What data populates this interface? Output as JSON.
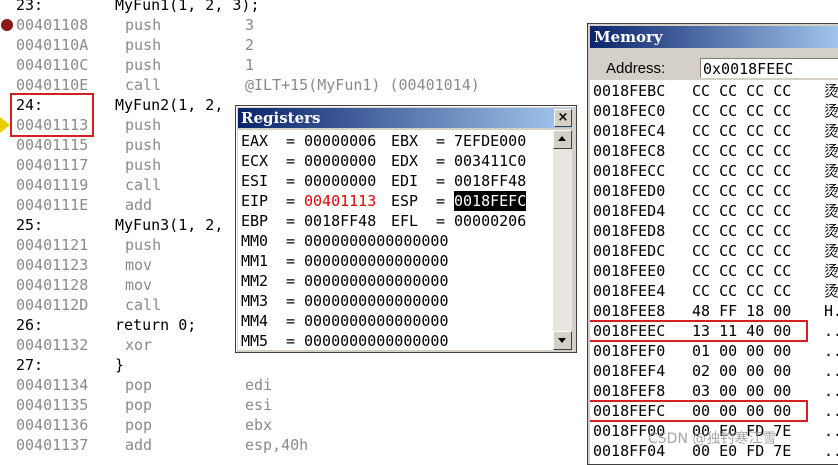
{
  "disassembly": [
    {
      "kind": "src",
      "num": "23:",
      "code": "MyFun1(1, 2, 3);"
    },
    {
      "kind": "asm",
      "addr": "00401108",
      "mnemonic": "push",
      "operand": "3",
      "marker": "breakpoint"
    },
    {
      "kind": "asm",
      "addr": "0040110A",
      "mnemonic": "push",
      "operand": "2"
    },
    {
      "kind": "asm",
      "addr": "0040110C",
      "mnemonic": "push",
      "operand": "1"
    },
    {
      "kind": "asm",
      "addr": "0040110E",
      "mnemonic": "call",
      "operand": "@ILT+15(MyFun1) (00401014)"
    },
    {
      "kind": "src",
      "num": "24:",
      "code": "MyFun2(1, 2,"
    },
    {
      "kind": "asm",
      "addr": "00401113",
      "mnemonic": "push",
      "operand": "",
      "marker": "current"
    },
    {
      "kind": "asm",
      "addr": "00401115",
      "mnemonic": "push",
      "operand": ""
    },
    {
      "kind": "asm",
      "addr": "00401117",
      "mnemonic": "push",
      "operand": ""
    },
    {
      "kind": "asm",
      "addr": "00401119",
      "mnemonic": "call",
      "operand": ""
    },
    {
      "kind": "asm",
      "addr": "0040111E",
      "mnemonic": "add",
      "operand": ""
    },
    {
      "kind": "src",
      "num": "25:",
      "code": "MyFun3(1, 2,"
    },
    {
      "kind": "asm",
      "addr": "00401121",
      "mnemonic": "push",
      "operand": ""
    },
    {
      "kind": "asm",
      "addr": "00401123",
      "mnemonic": "mov",
      "operand": ""
    },
    {
      "kind": "asm",
      "addr": "00401128",
      "mnemonic": "mov",
      "operand": ""
    },
    {
      "kind": "asm",
      "addr": "0040112D",
      "mnemonic": "call",
      "operand": ""
    },
    {
      "kind": "src",
      "num": "26:",
      "code": "return 0;"
    },
    {
      "kind": "asm",
      "addr": "00401132",
      "mnemonic": "xor",
      "operand": ""
    },
    {
      "kind": "src",
      "num": "27:",
      "code": "}"
    },
    {
      "kind": "asm",
      "addr": "00401134",
      "mnemonic": "pop",
      "operand": "edi"
    },
    {
      "kind": "asm",
      "addr": "00401135",
      "mnemonic": "pop",
      "operand": "esi"
    },
    {
      "kind": "asm",
      "addr": "00401136",
      "mnemonic": "pop",
      "operand": "ebx"
    },
    {
      "kind": "asm",
      "addr": "00401137",
      "mnemonic": "add",
      "operand": "esp,40h"
    }
  ],
  "registers": {
    "title": "Registers",
    "close": "×",
    "rows": [
      {
        "n1": "EAX",
        "v1": "00000006",
        "n2": "EBX",
        "v2": "7EFDE000"
      },
      {
        "n1": "ECX",
        "v1": "00000000",
        "n2": "EDX",
        "v2": "003411C0"
      },
      {
        "n1": "ESI",
        "v1": "00000000",
        "n2": "EDI",
        "v2": "0018FF48"
      },
      {
        "n1": "EIP",
        "v1": "00401113",
        "n2": "ESP",
        "v2": "0018FEFC",
        "v1_changed": true,
        "v2_selected": true
      },
      {
        "n1": "EBP",
        "v1": "0018FF48",
        "n2": "EFL",
        "v2": "00000206"
      },
      {
        "n1": "MM0",
        "v1": "0000000000000000"
      },
      {
        "n1": "MM1",
        "v1": "0000000000000000"
      },
      {
        "n1": "MM2",
        "v1": "0000000000000000"
      },
      {
        "n1": "MM3",
        "v1": "0000000000000000"
      },
      {
        "n1": "MM4",
        "v1": "0000000000000000"
      },
      {
        "n1": "MM5",
        "v1": "0000000000000000"
      }
    ],
    "eq": "="
  },
  "memory": {
    "title": "Memory",
    "address_label": "Address:",
    "address_value": "0x0018FEEC",
    "rows": [
      {
        "addr": "0018FEBC",
        "bytes": "CC CC CC CC",
        "ascii": "烫"
      },
      {
        "addr": "0018FEC0",
        "bytes": "CC CC CC CC",
        "ascii": "烫"
      },
      {
        "addr": "0018FEC4",
        "bytes": "CC CC CC CC",
        "ascii": "烫"
      },
      {
        "addr": "0018FEC8",
        "bytes": "CC CC CC CC",
        "ascii": "烫"
      },
      {
        "addr": "0018FECC",
        "bytes": "CC CC CC CC",
        "ascii": "烫"
      },
      {
        "addr": "0018FED0",
        "bytes": "CC CC CC CC",
        "ascii": "烫"
      },
      {
        "addr": "0018FED4",
        "bytes": "CC CC CC CC",
        "ascii": "烫"
      },
      {
        "addr": "0018FED8",
        "bytes": "CC CC CC CC",
        "ascii": "烫"
      },
      {
        "addr": "0018FEDC",
        "bytes": "CC CC CC CC",
        "ascii": "烫"
      },
      {
        "addr": "0018FEE0",
        "bytes": "CC CC CC CC",
        "ascii": "烫"
      },
      {
        "addr": "0018FEE4",
        "bytes": "CC CC CC CC",
        "ascii": "烫"
      },
      {
        "addr": "0018FEE8",
        "bytes": "48 FF 18 00",
        "ascii": "H."
      },
      {
        "addr": "0018FEEC",
        "bytes": "13 11 40 00",
        "ascii": "..",
        "highlight": true
      },
      {
        "addr": "0018FEF0",
        "bytes": "01 00 00 00",
        "ascii": ".."
      },
      {
        "addr": "0018FEF4",
        "bytes": "02 00 00 00",
        "ascii": ".."
      },
      {
        "addr": "0018FEF8",
        "bytes": "03 00 00 00",
        "ascii": ".."
      },
      {
        "addr": "0018FEFC",
        "bytes": "00 00 00 00",
        "ascii": "..",
        "highlight": true
      },
      {
        "addr": "0018FF00",
        "bytes": "00 E0 FD 7E",
        "ascii": ".."
      },
      {
        "addr": "0018FF04",
        "bytes": "00 E0 FD 7E",
        "ascii": ".."
      }
    ]
  },
  "watermark": "CSDN @独钓寒江雪",
  "colors": {
    "highlight_box": "#d42020",
    "eip_changed": "#e00000",
    "breakpoint": "#8b1a1a",
    "current_arrow": "#e8d000",
    "titlebar": "#0a246a"
  }
}
